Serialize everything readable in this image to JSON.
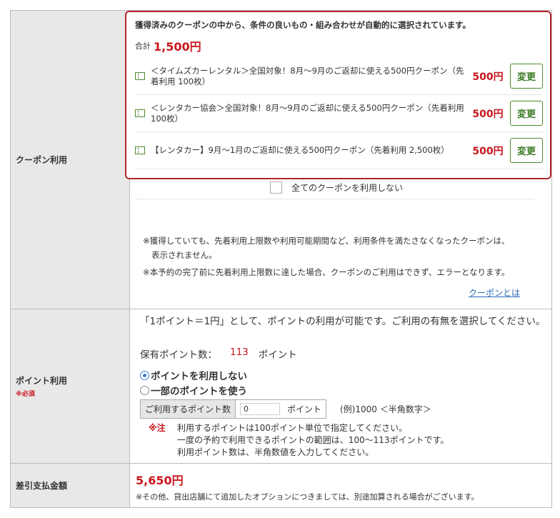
{
  "coupon": {
    "section_label": "クーポン利用",
    "heading": "獲得済みのクーポンの中から、条件の良いもの・組み合わせが自動的に選択されています。",
    "total_label": "合計",
    "total_value": "1,500円",
    "items": [
      {
        "text": "＜タイムズカーレンタル＞全国対象！8月〜9月のご返却に使える500円クーポン（先着利用 100枚）",
        "price": "500円",
        "button": "変更"
      },
      {
        "text": "＜レンタカー協会＞全国対象！8月〜9月のご返却に使える500円クーポン（先着利用 100枚）",
        "price": "500円",
        "button": "変更"
      },
      {
        "text": "【レンタカー】9月〜1月のご返却に使える500円クーポン（先着利用 2,500枚）",
        "price": "500円",
        "button": "変更"
      }
    ],
    "no_use_label": "全てのクーポンを利用しない",
    "note1_line1": "※獲得していても、先着利用上限数や利用可能期間など、利用条件を満たさなくなったクーポンは、",
    "note1_line2": "表示されません。",
    "note2": "※本予約の完了前に先着利用上限数に達した場合、クーポンのご利用はできず、エラーとなります。",
    "link": "クーポンとは"
  },
  "points": {
    "section_label": "ポイント利用",
    "required": "※必須",
    "description": "「1ポイント＝1円」として、ポイントの利用が可能です。ご利用の有無を選択してください。",
    "balance_label": "保有ポイント数：",
    "balance_value": "113",
    "balance_unit": "ポイント",
    "option_none": "ポイントを利用しない",
    "option_some": "一部のポイントを使う",
    "selected_option": "option_none",
    "input_label": "ご利用するポイント数",
    "input_value": "0",
    "input_unit": "ポイント",
    "example": "(例)1000 ＜半角数字＞",
    "note_mark": "※注",
    "note_lines": [
      "利用するポイントは100ポイント単位で指定してください。",
      "一度の予約で利用できるポイントの範囲は、100〜113ポイントです。",
      "利用ポイント数は、半角数値を入力してください。"
    ]
  },
  "payment": {
    "section_label": "差引支払金額",
    "value": "5,650円",
    "note": "※その他、貸出店舗にて追加したオプションにつきましては、別途加算される場合がございます。"
  },
  "colors": {
    "accent_red": "#c8161d",
    "highlight_border": "#b0262d",
    "button_green": "#4a8a2f",
    "link_blue": "#2a6bb8",
    "header_gray": "#e8e8e8"
  }
}
